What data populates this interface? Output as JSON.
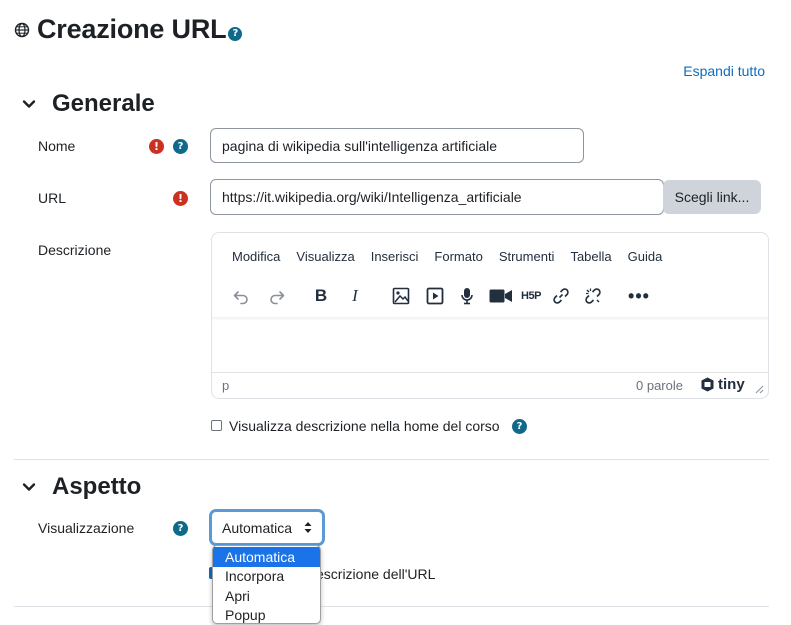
{
  "page": {
    "title": "Creazione URL",
    "expand_all": "Espandi tutto"
  },
  "sections": {
    "general": "Generale",
    "appearance": "Aspetto"
  },
  "fields": {
    "name_label": "Nome",
    "name_value": "pagina di wikipedia sull'intelligenza artificiale",
    "url_label": "URL",
    "url_value": "https://it.wikipedia.org/wiki/Intelligenza_artificiale",
    "choose_link": "Scegli link...",
    "description_label": "Descrizione",
    "show_description_label": "Visualizza descrizione nella home del corso",
    "display_label": "Visualizzazione",
    "display_value": "Automatica",
    "url_description_partial": "escrizione dell'URL"
  },
  "editor": {
    "menu": [
      "Modifica",
      "Visualizza",
      "Inserisci",
      "Formato",
      "Strumenti",
      "Tabella",
      "Guida"
    ],
    "status_path": "p",
    "word_count": "0 parole",
    "brand": "tiny",
    "toolbar_icons": [
      "undo-icon",
      "redo-icon",
      "bold-icon",
      "italic-icon",
      "image-icon",
      "media-icon",
      "microphone-icon",
      "video-camera-icon",
      "h5p-icon",
      "link-icon",
      "unlink-icon",
      "more-icon"
    ]
  },
  "dropdown": {
    "options": [
      "Automatica",
      "Incorpora",
      "Apri",
      "Popup"
    ],
    "selected_index": 0
  },
  "colors": {
    "link": "#0f6cbf",
    "error": "#ca3120",
    "help": "#0f6a8a",
    "select_focus": "#5b9bd5",
    "option_selected": "#1a73e8"
  }
}
